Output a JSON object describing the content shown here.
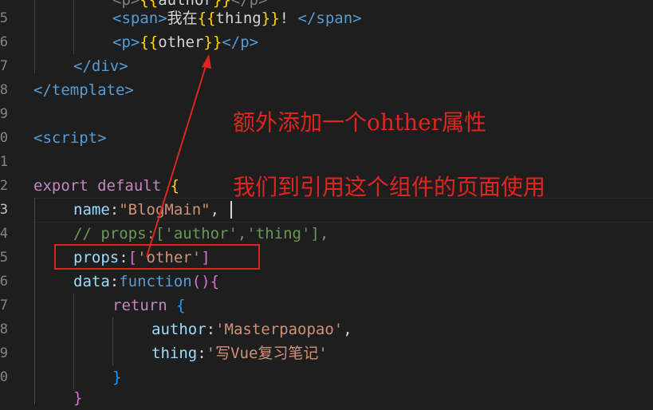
{
  "gutter": {
    "line_numbers": [
      "",
      "5",
      "6",
      "7",
      "8",
      "9",
      "0",
      "1",
      "2",
      "3",
      "4",
      "5",
      "6",
      "7",
      "8",
      "9",
      "0",
      ""
    ],
    "active_line": "3"
  },
  "code": {
    "l1": {
      "a": "<p>",
      "b": "{{",
      "c": "author",
      "d": "}}",
      "e": "</p>"
    },
    "l2": {
      "open": "<span>",
      "text": "我在",
      "b1": "{{",
      "var": "thing",
      "b2": "}}",
      "excl": "! ",
      "close": "</span>"
    },
    "l3": {
      "open": "<p>",
      "b1": "{{",
      "var": "other",
      "b2": "}}",
      "close": "</p>"
    },
    "l4": {
      "close": "</div>"
    },
    "l5": {
      "close": "</template>"
    },
    "l7": {
      "open": "<script>"
    },
    "l9": {
      "kw1": "export",
      "kw2": "default",
      "brace": "{"
    },
    "l10": {
      "key": "name",
      "colon": ":",
      "val": "\"BlogMain\"",
      "comma": ","
    },
    "l11": {
      "comment": "// props:['author','thing'],"
    },
    "l12": {
      "key": "props",
      "colon": ":",
      "lb": "[",
      "val": "'other'",
      "rb": "]"
    },
    "l13": {
      "key": "data",
      "colon": ":",
      "fn": "function",
      "parens": "()",
      "brace": "{"
    },
    "l14": {
      "kw": "return",
      "brace": "{"
    },
    "l15": {
      "key": "author",
      "colon": ":",
      "val": "'Masterpaopao'",
      "comma": ","
    },
    "l16": {
      "key": "thing",
      "colon": ":",
      "val": "'写Vue复习笔记'"
    },
    "l17": {
      "brace": "}"
    },
    "l18": {
      "brace": "}"
    }
  },
  "annotations": {
    "note1": "额外添加一个ohther属性",
    "note2": "我们到引用这个组件的页面使用"
  }
}
